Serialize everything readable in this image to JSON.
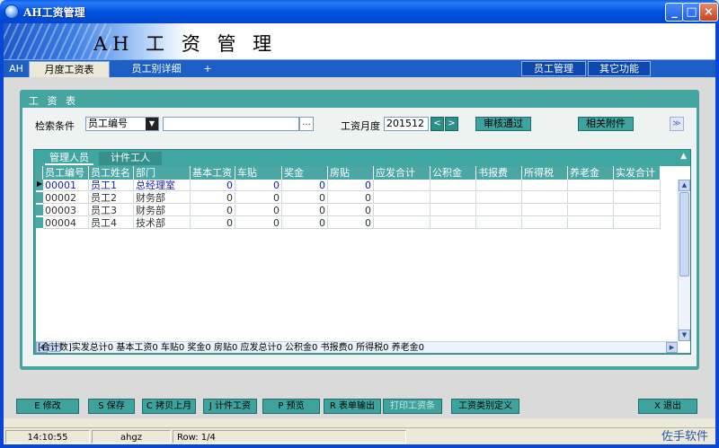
{
  "window": {
    "title": "AH工资管理"
  },
  "banner": {
    "title": "AH 工 资 管 理"
  },
  "tabs": [
    {
      "label": "AH"
    },
    {
      "label": "月度工资表"
    },
    {
      "label": "员工别详细"
    },
    {
      "label": "+"
    }
  ],
  "right_tabs": [
    {
      "label": "员工管理"
    },
    {
      "label": "其它功能"
    }
  ],
  "panel": {
    "title": "工 资 表"
  },
  "search": {
    "label": "检索条件",
    "field_value": "员工编号",
    "input_value": "",
    "ellipsis": "...",
    "month_label": "工资月度",
    "month_value": "201512",
    "prev": "<",
    "next": ">",
    "approve": "审核通过",
    "attach": "相关附件",
    "collapse": "≫"
  },
  "subtabs": [
    {
      "label": "管理人员"
    },
    {
      "label": "计件工人"
    }
  ],
  "grid": {
    "columns": [
      "员工编号",
      "员工姓名",
      "部门",
      "基本工资",
      "车贴",
      "奖金",
      "房贴",
      "应发合计",
      "公积金",
      "书报费",
      "所得税",
      "养老金",
      "实发合计"
    ],
    "rows": [
      {
        "id": "00001",
        "name": "员工1",
        "dept": "总经理室",
        "base": "0",
        "car": "0",
        "bonus": "0",
        "house": "0"
      },
      {
        "id": "00002",
        "name": "员工2",
        "dept": "财务部",
        "base": "0",
        "car": "0",
        "bonus": "0",
        "house": "0"
      },
      {
        "id": "00003",
        "name": "员工3",
        "dept": "财务部",
        "base": "0",
        "car": "0",
        "bonus": "0",
        "house": "0"
      },
      {
        "id": "00004",
        "name": "员工4",
        "dept": "技术部",
        "base": "0",
        "car": "0",
        "bonus": "0",
        "house": "0"
      }
    ]
  },
  "summary": "[合计数]实发总计0   基本工资0   车贴0   奖金0   房贴0   应发总计0   公积金0   书报费0   所得税0   养老金0",
  "buttons": [
    {
      "label": "E 修改"
    },
    {
      "label": "S 保存"
    },
    {
      "label": "C 拷贝上月"
    },
    {
      "label": "J 计件工资"
    },
    {
      "label": "P 预览"
    },
    {
      "label": "R 表单输出"
    },
    {
      "label": "打印工资条"
    },
    {
      "label": "工资类别定义"
    },
    {
      "label": "X 退出"
    }
  ],
  "status": {
    "time": "14:10:55",
    "user": "ahgz",
    "row": "Row: 1/4",
    "brand": "佐手软件"
  },
  "colors": {
    "title_bar": "#0053E0",
    "teal": "#3ea39f",
    "selected_text": "#1a1ab8"
  }
}
